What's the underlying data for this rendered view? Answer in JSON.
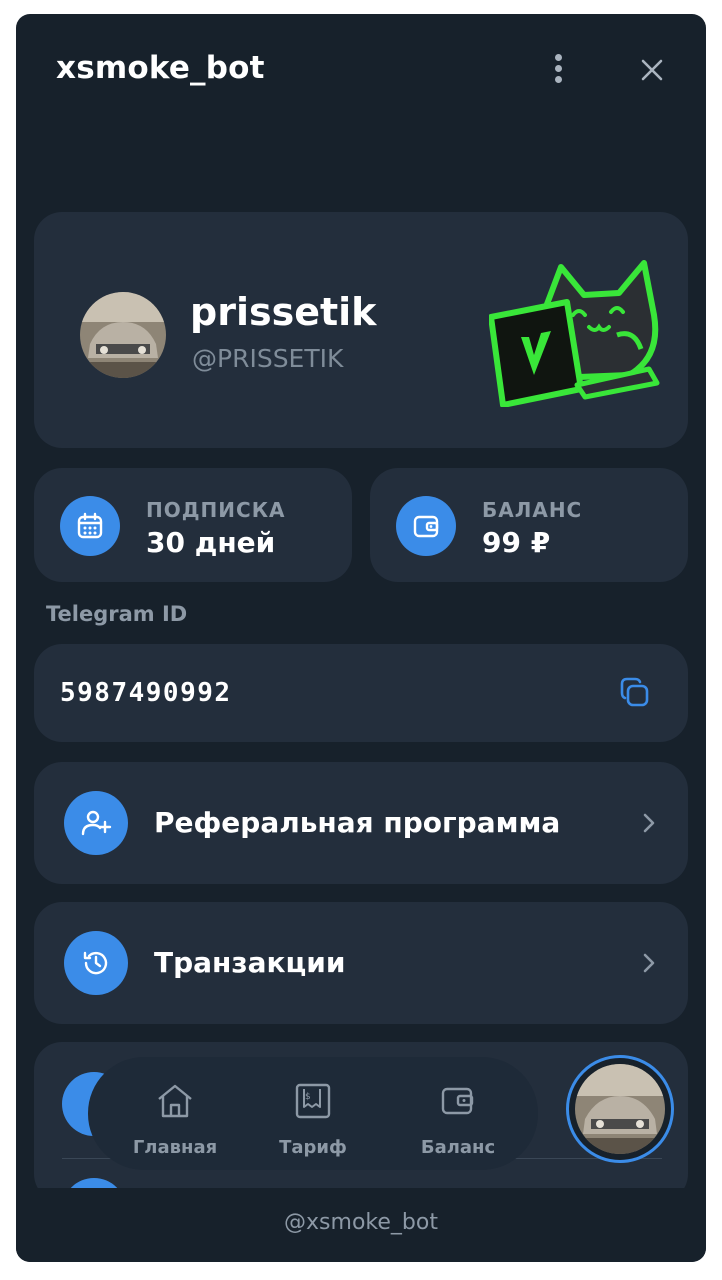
{
  "window": {
    "title": "xsmoke_bot"
  },
  "profile": {
    "name": "prissetik",
    "handle": "@PRISSETIK"
  },
  "stats": {
    "subscription": {
      "label": "ПОДПИСКА",
      "value": "30 дней",
      "icon": "calendar-icon"
    },
    "balance": {
      "label": "БАЛАНС",
      "value": "99 ₽",
      "icon": "wallet-icon"
    }
  },
  "telegram_id": {
    "label": "Telegram ID",
    "value": "5987490992"
  },
  "menu": [
    {
      "label": "Реферальная программа",
      "icon": "add-user-icon"
    },
    {
      "label": "Транзакции",
      "icon": "history-icon"
    }
  ],
  "nav": [
    {
      "label": "Главная",
      "icon": "home-icon"
    },
    {
      "label": "Тариф",
      "icon": "receipt-icon"
    },
    {
      "label": "Баланс",
      "icon": "wallet-icon"
    }
  ],
  "footer": {
    "text": "@xsmoke_bot"
  },
  "colors": {
    "background": "#17212b",
    "card": "#232e3c",
    "accent": "#3b8ce8",
    "mascot": "#39e639"
  }
}
